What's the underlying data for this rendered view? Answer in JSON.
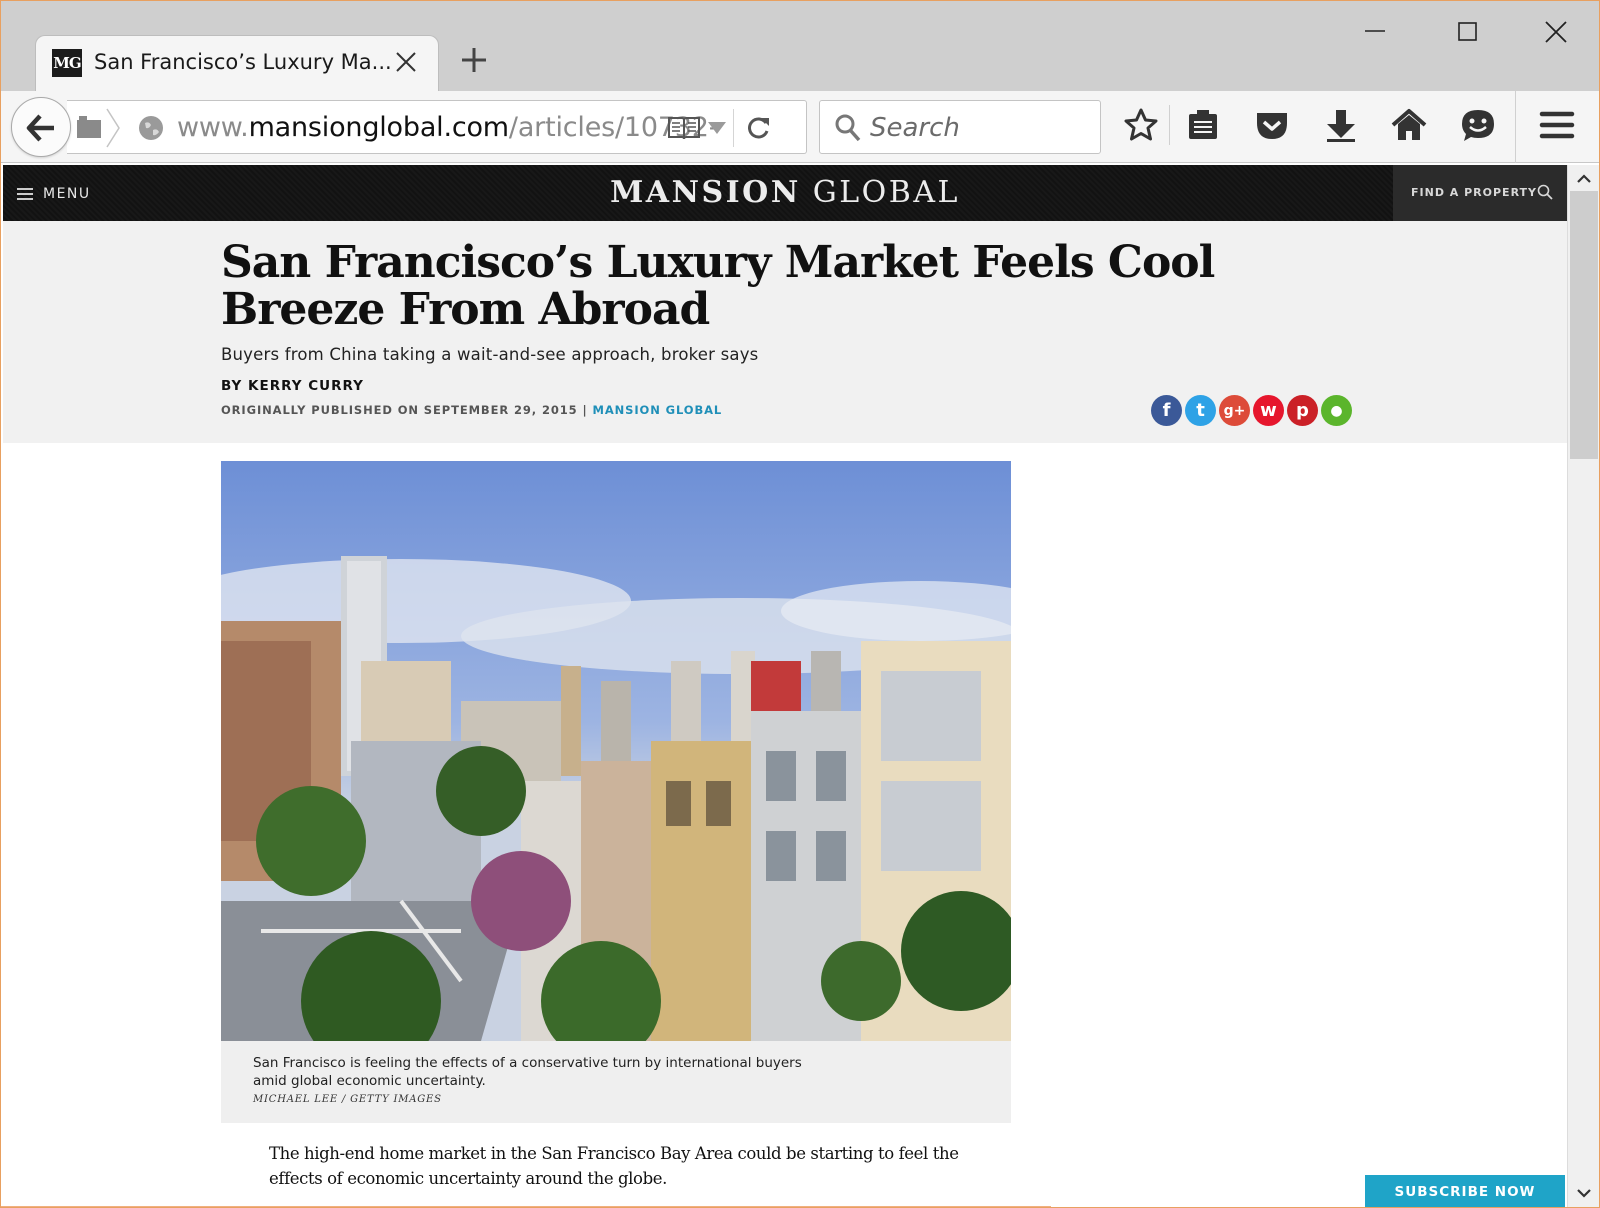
{
  "browser": {
    "tab": {
      "favicon_text": "MG",
      "title": "San Francisco’s Luxury Ma..."
    },
    "url": {
      "prefix": "www.",
      "domain": "mansionglobal.com",
      "path": "/articles/10732-"
    },
    "search": {
      "placeholder": "Search"
    },
    "toolbar_icons": [
      "bookmark-star-icon",
      "reading-list-icon",
      "pocket-icon",
      "download-icon",
      "home-icon",
      "hello-chat-icon",
      "hamburger-menu-icon"
    ]
  },
  "site": {
    "menu_label": "MENU",
    "logo_strong": "MANSION",
    "logo_light": "GLOBAL",
    "find_property_label": "FIND A PROPERTY"
  },
  "article": {
    "headline": "San Francisco’s Luxury Market Feels Cool Breeze From Abroad",
    "dek": "Buyers from China taking a wait-and-see approach, broker says",
    "byline": "BY KERRY CURRY",
    "published": "ORIGINALLY PUBLISHED ON SEPTEMBER 29, 2015",
    "separator": "|",
    "source": "MANSION GLOBAL",
    "share": [
      {
        "name": "facebook-icon",
        "glyph": "f",
        "color": "#3b5998"
      },
      {
        "name": "twitter-icon",
        "glyph": "t",
        "color": "#2ea2e6"
      },
      {
        "name": "google-plus-icon",
        "glyph": "g+",
        "color": "#dd4b39"
      },
      {
        "name": "weibo-icon",
        "glyph": "w",
        "color": "#e6162d"
      },
      {
        "name": "pinterest-icon",
        "glyph": "p",
        "color": "#cb2027"
      },
      {
        "name": "wechat-icon",
        "glyph": "●",
        "color": "#5bb52c"
      }
    ],
    "photo_caption": "San Francisco is feeling the effects of a conservative turn by international buyers amid global economic uncertainty.",
    "photo_credit": "MICHAEL LEE / GETTY IMAGES",
    "lead_paragraph": "The high-end home market in the San Francisco Bay Area could be starting to feel the effects of economic uncertainty around the globe."
  },
  "subscribe_label": "SUBSCRIBE NOW",
  "colors": {
    "accent": "#1fa4c8",
    "header_bg": "#141414",
    "source_link": "#1f8fb8"
  }
}
